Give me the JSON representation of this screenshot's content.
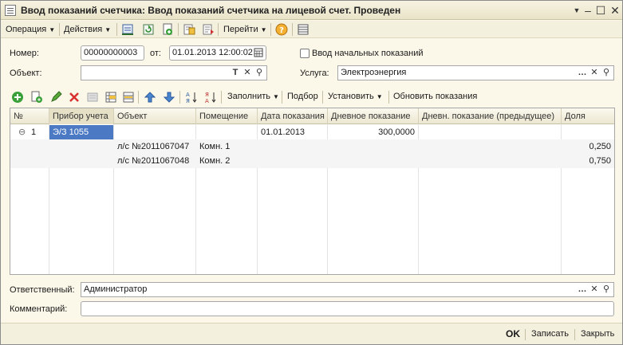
{
  "window": {
    "title": "Ввод показаний счетчика: Ввод показаний счетчика на лицевой счет. Проведен"
  },
  "toolbar": {
    "operation_label": "Операция",
    "actions_label": "Действия",
    "goto_label": "Перейти"
  },
  "form": {
    "number_label": "Номер:",
    "number_value": "00000000003",
    "date_label": "от:",
    "date_value": "01.01.2013 12:00:02",
    "initial_readings_label": "Ввод начальных показаний",
    "initial_readings_checked": false,
    "object_label": "Объект:",
    "object_value": "",
    "service_label": "Услуга:",
    "service_value": "Электроэнергия"
  },
  "grid_toolbar": {
    "fill_label": "Заполнить",
    "selection_label": "Подбор",
    "set_label": "Установить",
    "update_label": "Обновить показания"
  },
  "table": {
    "columns": [
      "№",
      "Прибор учета",
      "Объект",
      "Помещение",
      "Дата показания",
      "Дневное показание",
      "Дневн. показание (предыдущее)",
      "Доля"
    ],
    "rows": [
      {
        "num": "1",
        "device": "Э/З 1055",
        "object": "",
        "room": "",
        "date": "01.01.2013",
        "day_reading": "300,0000",
        "prev_reading": "",
        "share": ""
      },
      {
        "num": "",
        "device": "",
        "object": "л/с №2011067047",
        "room": "Комн. 1",
        "date": "",
        "day_reading": "",
        "prev_reading": "",
        "share": "0,250"
      },
      {
        "num": "",
        "device": "",
        "object": "л/с №2011067048",
        "room": "Комн. 2",
        "date": "",
        "day_reading": "",
        "prev_reading": "",
        "share": "0,750"
      }
    ]
  },
  "bottom": {
    "responsible_label": "Ответственный:",
    "responsible_value": "Администратор",
    "comment_label": "Комментарий:",
    "comment_value": ""
  },
  "footer": {
    "ok_label": "OK",
    "save_label": "Записать",
    "close_label": "Закрыть"
  },
  "colors": {
    "selection": "#4b79c4",
    "window_bg": "#fbf7e9"
  }
}
